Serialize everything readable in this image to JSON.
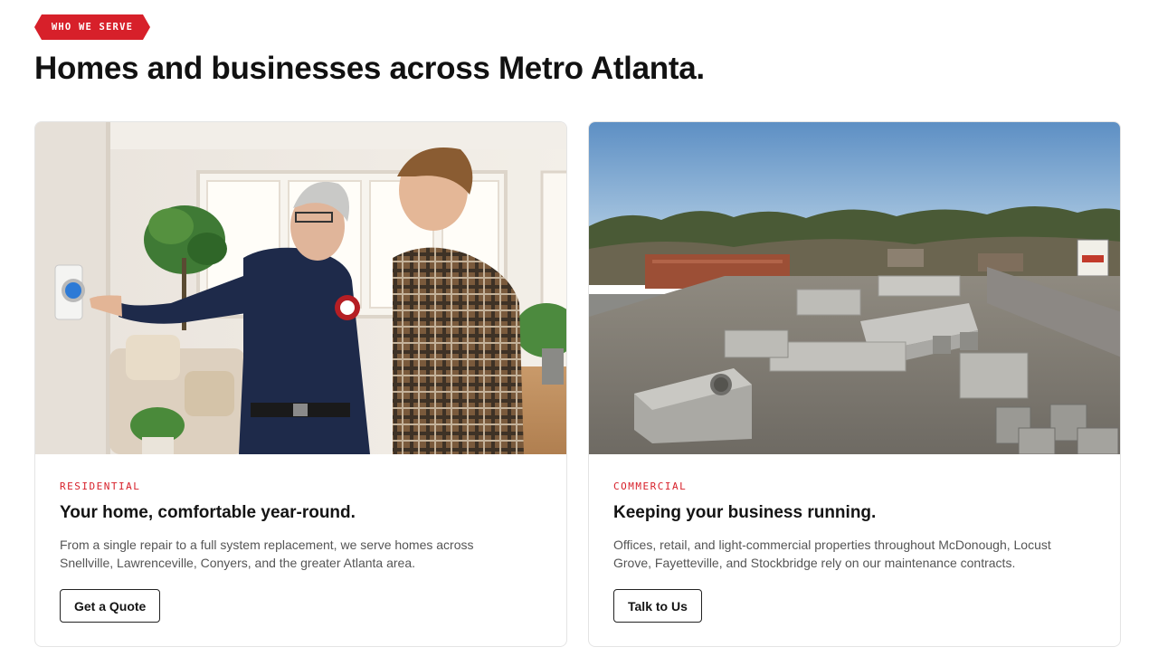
{
  "section_tag": "WHO WE SERVE",
  "headline": "Homes and businesses across Metro Atlanta.",
  "cards": [
    {
      "category": "RESIDENTIAL",
      "title": "Your home, comfortable year-round.",
      "description": "From a single repair to a full system replacement, we serve homes across Snellville, Lawrenceville, Conyers, and the greater Atlanta area.",
      "button_label": "Get a Quote",
      "image": "technician-and-homeowner-at-thermostat-photo"
    },
    {
      "category": "COMMERCIAL",
      "title": "Keeping your business running.",
      "description": "Offices, retail, and light-commercial properties throughout McDonough, Locust Grove, Fayetteville, and Stockbridge rely on our maintenance contracts.",
      "button_label": "Talk to Us",
      "image": "commercial-rooftop-hvac-units-photo"
    }
  ],
  "colors": {
    "accent": "#d7202a",
    "text": "#141414",
    "muted": "#555555",
    "border": "#e4e4e4"
  }
}
